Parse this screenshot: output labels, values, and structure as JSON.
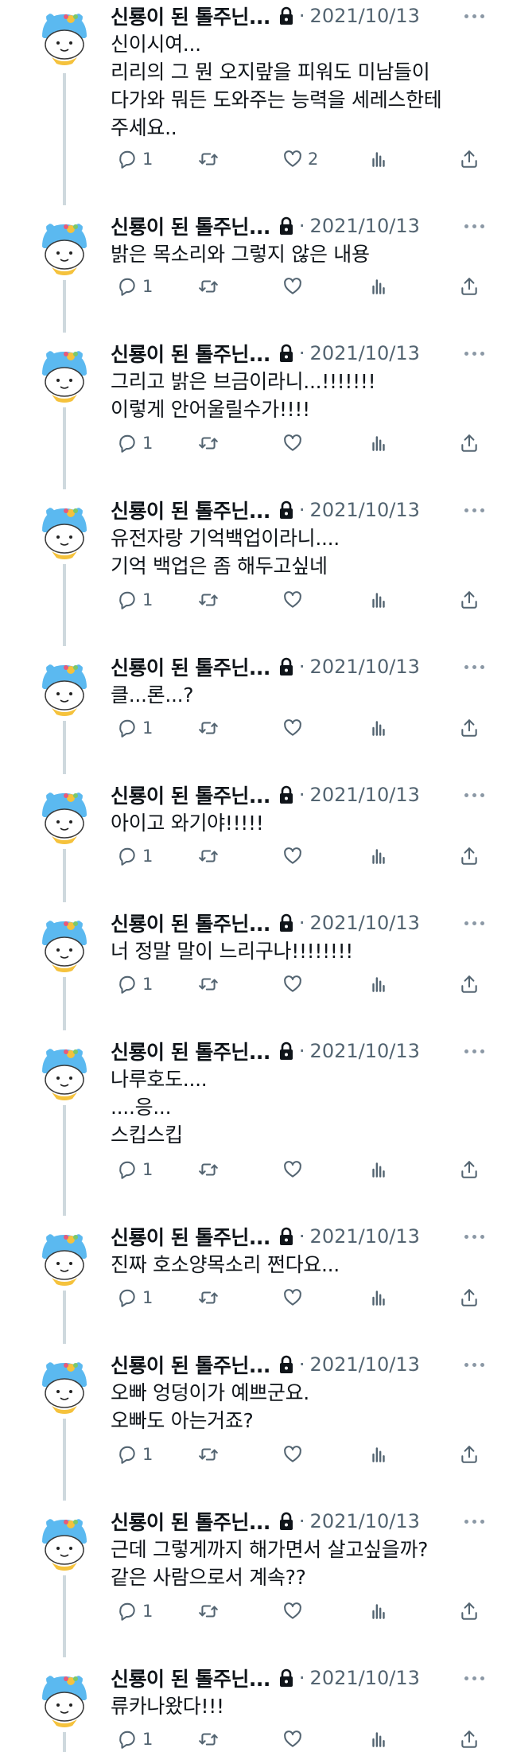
{
  "colors": {
    "text": "#0f1419",
    "muted": "#536471",
    "thread_line": "#cfd9de",
    "avatar_blue": "#5bb9f0",
    "avatar_scarf": "#f5c23c"
  },
  "icons": {
    "avatar": "mascot-avatar-icon",
    "lock": "lock-icon",
    "more": "more-icon",
    "reply": "reply-icon",
    "retweet": "retweet-icon",
    "like": "like-icon",
    "views": "views-icon",
    "share": "share-icon"
  },
  "tweets": [
    {
      "name": "신룡이 된 톨주닌...",
      "separator": "·",
      "date": "2021/10/13",
      "lines": [
        "신이시여...",
        "리리의 그 뭔 오지랖을 피워도 미남들이",
        "다가와 뭐든 도와주는 능력을 세레스한테",
        "주세요.."
      ],
      "replies": "1",
      "retweets": "",
      "likes": "2"
    },
    {
      "name": "신룡이 된 톨주닌...",
      "separator": "·",
      "date": "2021/10/13",
      "lines": [
        "밝은 목소리와 그렇지 않은 내용"
      ],
      "replies": "1",
      "retweets": "",
      "likes": ""
    },
    {
      "name": "신룡이 된 톨주닌...",
      "separator": "·",
      "date": "2021/10/13",
      "lines": [
        "그리고 밝은 브금이라니...!!!!!!!",
        "이렇게 안어울릴수가!!!!"
      ],
      "replies": "1",
      "retweets": "",
      "likes": ""
    },
    {
      "name": "신룡이 된 톨주닌...",
      "separator": "·",
      "date": "2021/10/13",
      "lines": [
        "유전자랑 기억백업이라니....",
        "기억 백업은 좀 해두고싶네"
      ],
      "replies": "1",
      "retweets": "",
      "likes": ""
    },
    {
      "name": "신룡이 된 톨주닌...",
      "separator": "·",
      "date": "2021/10/13",
      "lines": [
        "클...론...?"
      ],
      "replies": "1",
      "retweets": "",
      "likes": ""
    },
    {
      "name": "신룡이 된 톨주닌...",
      "separator": "·",
      "date": "2021/10/13",
      "lines": [
        "아이고 와기야!!!!!"
      ],
      "replies": "1",
      "retweets": "",
      "likes": ""
    },
    {
      "name": "신룡이 된 톨주닌...",
      "separator": "·",
      "date": "2021/10/13",
      "lines": [
        "너 정말 말이 느리구나!!!!!!!!"
      ],
      "replies": "1",
      "retweets": "",
      "likes": ""
    },
    {
      "name": "신룡이 된 톨주닌...",
      "separator": "·",
      "date": "2021/10/13",
      "lines": [
        "나루호도....",
        "....응...",
        "스킵스킵"
      ],
      "replies": "1",
      "retweets": "",
      "likes": ""
    },
    {
      "name": "신룡이 된 톨주닌...",
      "separator": "·",
      "date": "2021/10/13",
      "lines": [
        "진짜 호소양목소리 쩐다요..."
      ],
      "replies": "1",
      "retweets": "",
      "likes": ""
    },
    {
      "name": "신룡이 된 톨주닌...",
      "separator": "·",
      "date": "2021/10/13",
      "lines": [
        "오빠 엉덩이가 예쁘군요.",
        "오빠도 아는거죠?"
      ],
      "replies": "1",
      "retweets": "",
      "likes": ""
    },
    {
      "name": "신룡이 된 톨주닌...",
      "separator": "·",
      "date": "2021/10/13",
      "lines": [
        "근데 그렇게까지 해가면서 살고싶을까?",
        "같은 사람으로서 계속??"
      ],
      "replies": "1",
      "retweets": "",
      "likes": ""
    },
    {
      "name": "신룡이 된 톨주닌...",
      "separator": "·",
      "date": "2021/10/13",
      "lines": [
        "류카나왔다!!!"
      ],
      "replies": "1",
      "retweets": "",
      "likes": ""
    }
  ]
}
